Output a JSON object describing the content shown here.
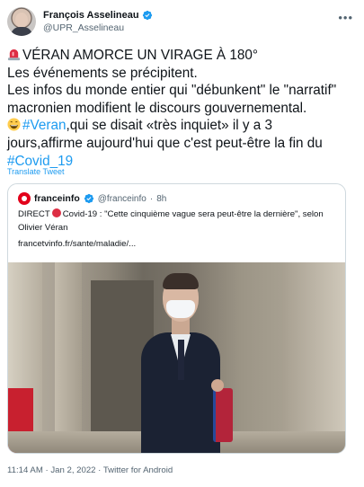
{
  "author": {
    "display_name": "François Asselineau",
    "handle": "@UPR_Asselineau"
  },
  "tweet": {
    "lines": [
      "VÉRAN AMORCE UN VIRAGE À 180°",
      "Les événements se précipitent.",
      "Les infos du monde entier qui \"débunkent\" le \"narratif\"",
      "macronien modifient le discours gouvernemental.",
      ",qui se disait «très inquiet» il y a 3",
      "jours,affirme aujourd'hui que c'est peut-être la fin du"
    ],
    "hashtag_1": "#Veran",
    "hashtag_2": "#Covid_19",
    "translate_label": "Translate Tweet"
  },
  "quoted": {
    "name": "franceinfo",
    "handle": "@franceinfo",
    "separator": "·",
    "time": "8h",
    "text_prefix": "DIRECT",
    "text_line_1": "Covid-19 : \"Cette cinquième vague sera peut-être la dernière\", selon",
    "text_line_2": "Olivier Véran",
    "link": "francetvinfo.fr/sante/maladie/..."
  },
  "meta": {
    "text": "11:14 AM · Jan 2, 2022 · Twitter for Android"
  },
  "icons": {
    "verified": "verified-badge-icon",
    "more": "more-options-icon",
    "siren": "rotating-light-emoji",
    "grin": "grinning-face-emoji",
    "red_circle": "red-circle-emoji"
  },
  "colors": {
    "link_blue": "#1d9bf0",
    "text": "#0f1419",
    "secondary": "#536471",
    "border": "#cfd9de"
  }
}
